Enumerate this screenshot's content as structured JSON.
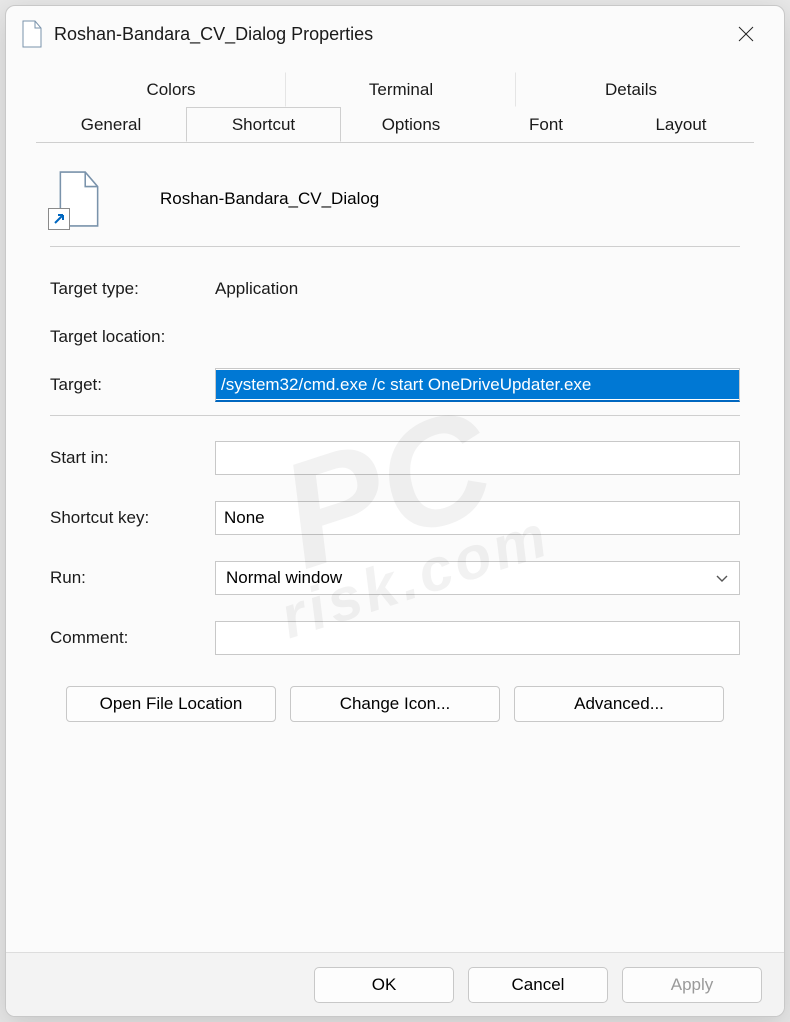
{
  "window": {
    "title": "Roshan-Bandara_CV_Dialog Properties"
  },
  "tabs": {
    "row1": [
      "Colors",
      "Terminal",
      "Details"
    ],
    "row2": [
      "General",
      "Shortcut",
      "Options",
      "Font",
      "Layout"
    ],
    "active": "Shortcut"
  },
  "shortcut": {
    "file_name": "Roshan-Bandara_CV_Dialog",
    "labels": {
      "target_type": "Target type:",
      "target_location": "Target location:",
      "target": "Target:",
      "start_in": "Start in:",
      "shortcut_key": "Shortcut key:",
      "run": "Run:",
      "comment": "Comment:"
    },
    "target_type_value": "Application",
    "target_location_value": "",
    "target_value": "/system32/cmd.exe /c start OneDriveUpdater.exe",
    "start_in_value": "",
    "shortcut_key_value": "None",
    "run_value": "Normal window",
    "comment_value": ""
  },
  "buttons": {
    "open_location": "Open File Location",
    "change_icon": "Change Icon...",
    "advanced": "Advanced..."
  },
  "footer": {
    "ok": "OK",
    "cancel": "Cancel",
    "apply": "Apply"
  },
  "watermark": {
    "line1": "PC",
    "line2": "risk.com"
  }
}
